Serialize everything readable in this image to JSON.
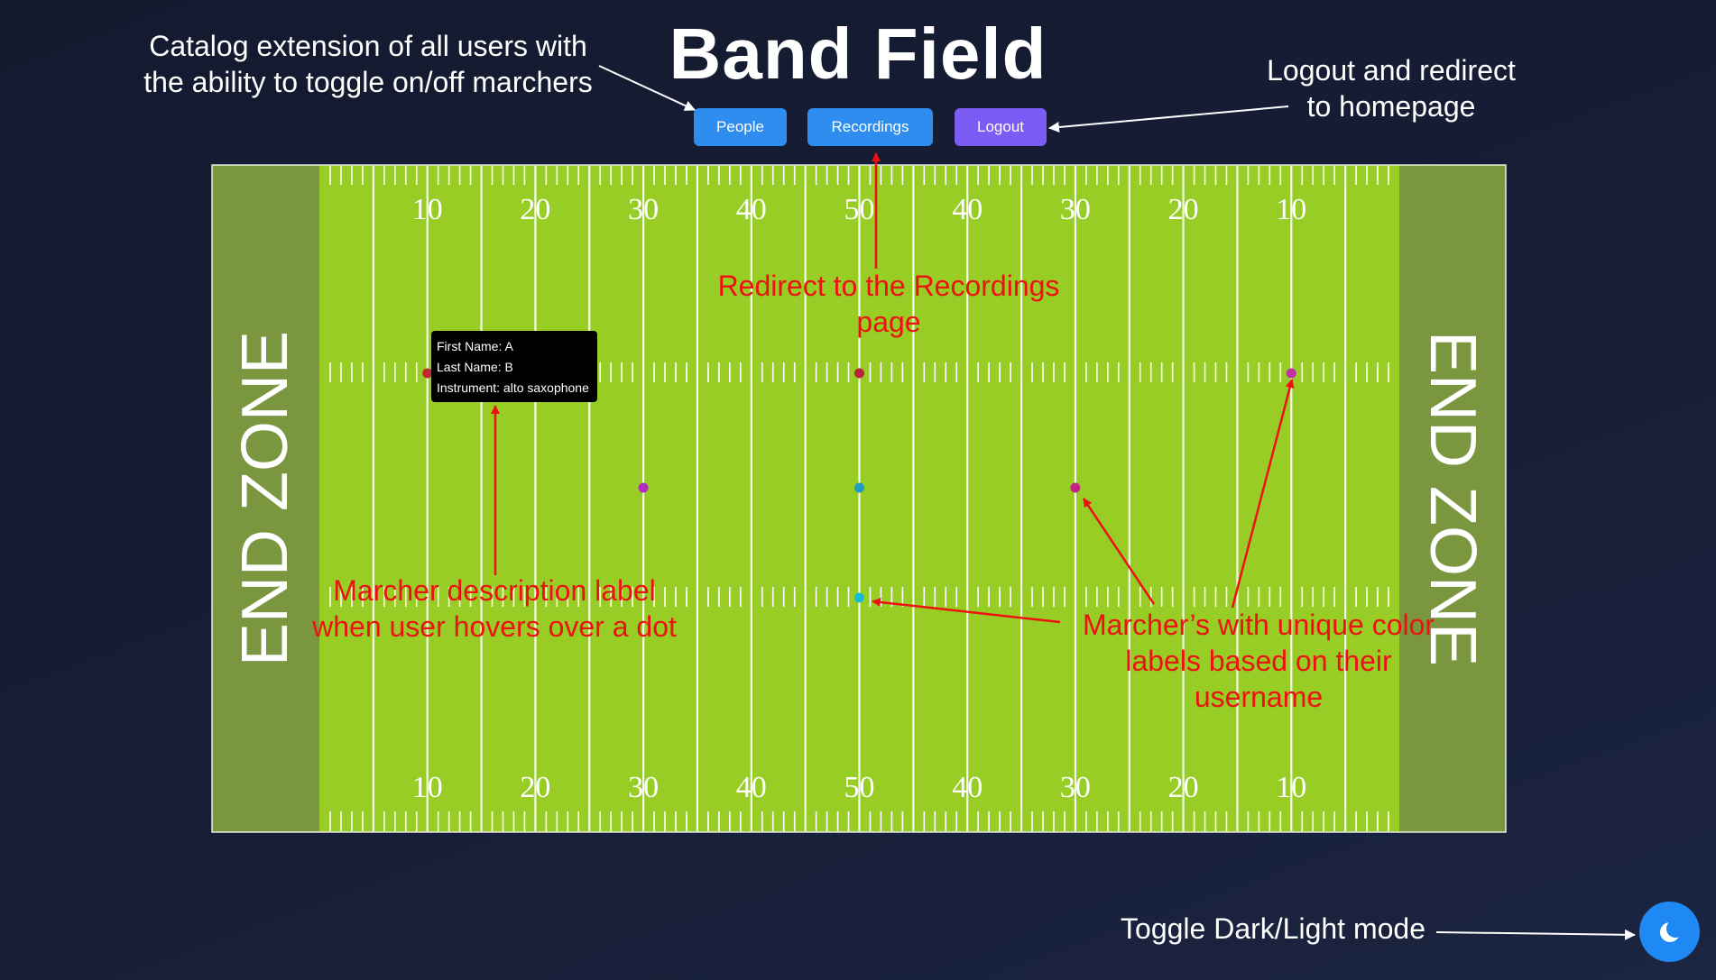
{
  "header": {
    "title": "Band Field"
  },
  "nav": {
    "people_label": "People",
    "recordings_label": "Recordings",
    "logout_label": "Logout"
  },
  "colors": {
    "field_green": "#98cd26",
    "endzone_green": "#7a9740",
    "people_blue": "#2f8df0",
    "logout_purple": "#7b5cf5",
    "toggle_blue": "#1e88f5",
    "annotation_red": "#ee1111"
  },
  "field": {
    "left_endzone_label": "END ZONE",
    "right_endzone_label": "END ZONE",
    "yard_numbers": [
      "10",
      "20",
      "30",
      "40",
      "50",
      "40",
      "30",
      "20",
      "10"
    ]
  },
  "marchers": [
    {
      "yard": 10,
      "lane": "upper",
      "color": "#c2292d"
    },
    {
      "yard": 50,
      "lane": "upper",
      "color": "#b8253a"
    },
    {
      "yard": 90,
      "lane": "upper",
      "color": "#c22fa5"
    },
    {
      "yard": 30,
      "lane": "middle",
      "color": "#b52bc0"
    },
    {
      "yard": 50,
      "lane": "middle",
      "color": "#1f9bc4"
    },
    {
      "yard": 70,
      "lane": "middle",
      "color": "#c42584"
    },
    {
      "yard": 50,
      "lane": "lower",
      "color": "#18bcd0"
    }
  ],
  "tooltip": {
    "first_name": "First Name: A",
    "last_name": "Last Name: B",
    "instrument": "Instrument: alto saxophone"
  },
  "annotations": {
    "people": [
      "Catalog extension of all users with",
      "the ability to toggle on/off marchers"
    ],
    "logout": [
      "Logout and redirect",
      "to homepage"
    ],
    "recordings": [
      "Redirect to the Recordings",
      "page"
    ],
    "hover": [
      "Marcher description label",
      "when user hovers over a dot"
    ],
    "colors": [
      "Marcher’s with unique color",
      "labels based on their",
      "username"
    ],
    "toggle": "Toggle Dark/Light mode"
  },
  "theme_toggle": {
    "icon": "moon-icon"
  }
}
